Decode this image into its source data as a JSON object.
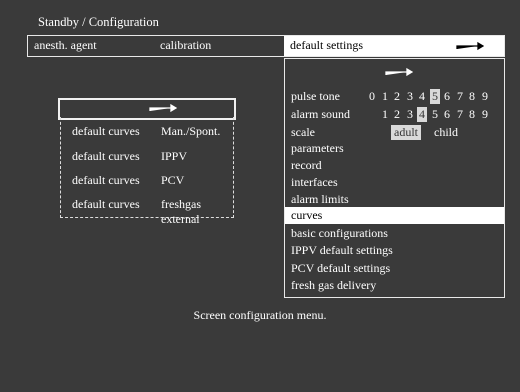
{
  "header": {
    "title": "Standby / Configuration"
  },
  "tabs": [
    {
      "label": "anesth. agent"
    },
    {
      "label": "calibration"
    },
    {
      "label": "default settings"
    }
  ],
  "right_menu": {
    "pulse_tone": {
      "label": "pulse tone",
      "values": [
        "0",
        "1",
        "2",
        "3",
        "4",
        "5",
        "6",
        "7",
        "8",
        "9"
      ],
      "selected": "5"
    },
    "alarm_sound": {
      "label": "alarm sound",
      "values": [
        "1",
        "2",
        "3",
        "4",
        "5",
        "6",
        "7",
        "8",
        "9"
      ],
      "selected": "4"
    },
    "scale": {
      "label": "scale",
      "options": [
        "adult",
        "child"
      ],
      "selected": "adult"
    },
    "items": [
      "parameters",
      "record",
      "interfaces",
      "alarm limits",
      "curves",
      "basic configurations",
      "IPPV default settings",
      "PCV default settings",
      "fresh gas delivery"
    ],
    "selected_item": "curves"
  },
  "left_menu": {
    "rows": [
      {
        "label": "default curves",
        "value": "Man./Spont."
      },
      {
        "label": "default curves",
        "value": "IPPV"
      },
      {
        "label": "default curves",
        "value": "PCV"
      },
      {
        "label": "default curves",
        "value": "freshgas external"
      }
    ]
  },
  "caption": "Screen configuration menu.",
  "colors": {
    "background": "#3a3a3a",
    "highlight": "#ffffff",
    "text": "#ffffff"
  }
}
